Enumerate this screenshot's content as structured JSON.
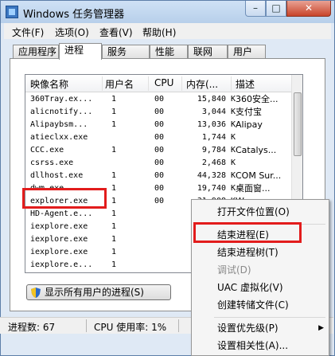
{
  "window": {
    "title": "Windows 任务管理器"
  },
  "menubar": [
    "文件(F)",
    "选项(O)",
    "查看(V)",
    "帮助(H)"
  ],
  "tabs": [
    "应用程序",
    "进程",
    "服务",
    "性能",
    "联网",
    "用户"
  ],
  "active_tab": "进程",
  "columns": [
    "映像名称",
    "用户名",
    "CPU",
    "内存(...",
    "描述"
  ],
  "rows": [
    {
      "name": "360Tray.ex...",
      "user": "1",
      "cpu": "00",
      "mem": "15,840",
      "k": "K",
      "desc": "360安全..."
    },
    {
      "name": "alicnotify...",
      "user": "1",
      "cpu": "00",
      "mem": "3,044",
      "k": "K",
      "desc": "支付宝"
    },
    {
      "name": "Alipaybsm...",
      "user": "1",
      "cpu": "00",
      "mem": "13,036",
      "k": "K",
      "desc": "Alipay"
    },
    {
      "name": "atieclxx.exe",
      "user": "",
      "cpu": "00",
      "mem": "1,744",
      "k": "K",
      "desc": ""
    },
    {
      "name": "CCC.exe",
      "user": "1",
      "cpu": "00",
      "mem": "9,784",
      "k": "K",
      "desc": "Catalys..."
    },
    {
      "name": "csrss.exe",
      "user": "",
      "cpu": "00",
      "mem": "2,468",
      "k": "K",
      "desc": ""
    },
    {
      "name": "dllhost.exe",
      "user": "1",
      "cpu": "00",
      "mem": "44,328",
      "k": "K",
      "desc": "COM Sur..."
    },
    {
      "name": "dwm.exe",
      "user": "1",
      "cpu": "00",
      "mem": "19,740",
      "k": "K",
      "desc": "桌面窗..."
    },
    {
      "name": "explorer.exe",
      "user": "1",
      "cpu": "00",
      "mem": "31,908",
      "k": "K",
      "desc": "W..."
    },
    {
      "name": "HD-Agent.e...",
      "user": "1",
      "cpu": "",
      "mem": "",
      "k": "",
      "desc": ""
    },
    {
      "name": "iexplore.exe",
      "user": "1",
      "cpu": "",
      "mem": "",
      "k": "",
      "desc": ""
    },
    {
      "name": "iexplore.exe",
      "user": "1",
      "cpu": "",
      "mem": "",
      "k": "",
      "desc": ""
    },
    {
      "name": "iexplore.exe",
      "user": "1",
      "cpu": "",
      "mem": "",
      "k": "",
      "desc": ""
    },
    {
      "name": "iexplore.e...",
      "user": "1",
      "cpu": "",
      "mem": "",
      "k": "",
      "desc": ""
    }
  ],
  "show_all_button": "显示所有用户的进程(S)",
  "status": {
    "processes": "进程数: 67",
    "cpu": "CPU 使用率: 1%"
  },
  "context_menu": {
    "open_location": "打开文件位置(O)",
    "end_process": "结束进程(E)",
    "end_tree": "结束进程树(T)",
    "debug": "调试(D)",
    "uac": "UAC 虚拟化(V)",
    "dump": "创建转储文件(C)",
    "priority": "设置优先级(P)",
    "affinity": "设置相关性(A)..."
  },
  "colors": {
    "highlight": "#e21c1c",
    "title_bar": "#b7cfea",
    "close_button": "#c8442a"
  },
  "icons": [
    "app-icon",
    "minimize-icon",
    "maximize-icon",
    "close-icon",
    "shield-icon",
    "submenu-arrow-icon"
  ]
}
